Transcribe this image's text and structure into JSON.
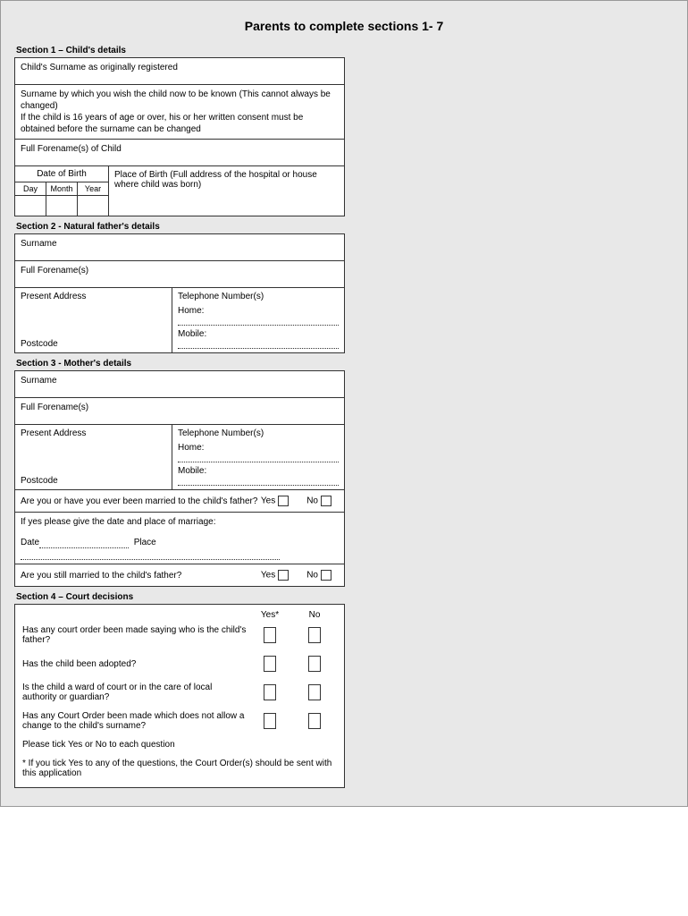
{
  "title": "Parents to complete sections 1- 7",
  "section1": {
    "header": "Section 1 – Child's details",
    "surname_registered": "Child's Surname as originally registered",
    "surname_wish_line1": "Surname by which you wish the child now to be known (This cannot always be changed)",
    "surname_wish_line2": "If the child is 16 years of age or over, his or her written consent must be obtained before the surname can be changed",
    "forenames": "Full Forename(s) of Child",
    "dob_label": "Date of Birth",
    "day": "Day",
    "month": "Month",
    "year": "Year",
    "pob": "Place of Birth (Full address of the hospital or house where child was born)"
  },
  "section2": {
    "header": "Section 2 - Natural father's details",
    "surname": "Surname",
    "forenames": "Full Forename(s)",
    "address": "Present Address",
    "postcode": "Postcode",
    "telephone": "Telephone Number(s)",
    "home": "Home:",
    "mobile": "Mobile:"
  },
  "section3": {
    "header": "Section 3 - Mother's details",
    "surname": "Surname",
    "forenames": "Full Forename(s)",
    "address": "Present Address",
    "postcode": "Postcode",
    "telephone": "Telephone Number(s)",
    "home": "Home:",
    "mobile": "Mobile:",
    "q_ever_married": "Are you or have you ever been married to the child's father?",
    "yes": "Yes",
    "no": "No",
    "marriage_line": "If yes please give the date and place of marriage:",
    "date_label": "Date",
    "place_label": "Place",
    "q_still_married": "Are you still married to the child's father?"
  },
  "section4": {
    "header": "Section 4 – Court decisions",
    "yes_star": "Yes*",
    "no": "No",
    "q1": "Has any court order been made saying who is the child's father?",
    "q2": "Has the child been adopted?",
    "q3": "Is the child a ward of court or in the care of local authority or guardian?",
    "q4": "Has any Court Order been made which does not allow a change to the child's surname?",
    "tick_note": "Please tick Yes or No to each question",
    "footnote": "* If you tick Yes to any of the questions, the Court Order(s) should be sent with this application"
  }
}
